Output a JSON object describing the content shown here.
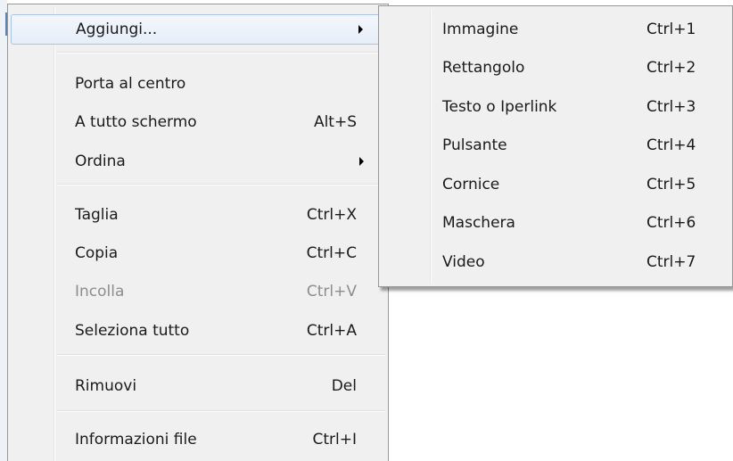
{
  "main_menu": {
    "add": {
      "label": "Aggiungi..."
    },
    "bring_to_center": {
      "label": "Porta al centro"
    },
    "full_screen": {
      "label": "A tutto schermo",
      "shortcut": "Alt+S"
    },
    "order": {
      "label": "Ordina"
    },
    "cut": {
      "label": "Taglia",
      "shortcut": "Ctrl+X"
    },
    "copy": {
      "label": "Copia",
      "shortcut": "Ctrl+C"
    },
    "paste": {
      "label": "Incolla",
      "shortcut": "Ctrl+V",
      "disabled": true
    },
    "select_all": {
      "label": "Seleziona tutto",
      "shortcut": "Ctrl+A"
    },
    "remove": {
      "label": "Rimuovi",
      "shortcut": "Del"
    },
    "file_info": {
      "label": "Informazioni file",
      "shortcut": "Ctrl+I"
    }
  },
  "submenu": {
    "image": {
      "label": "Immagine",
      "shortcut": "Ctrl+1"
    },
    "rectangle": {
      "label": "Rettangolo",
      "shortcut": "Ctrl+2"
    },
    "text_link": {
      "label": "Testo o Iperlink",
      "shortcut": "Ctrl+3"
    },
    "button": {
      "label": "Pulsante",
      "shortcut": "Ctrl+4"
    },
    "frame": {
      "label": "Cornice",
      "shortcut": "Ctrl+5"
    },
    "mask": {
      "label": "Maschera",
      "shortcut": "Ctrl+6"
    },
    "video": {
      "label": "Video",
      "shortcut": "Ctrl+7"
    }
  },
  "icons": {
    "submenu_arrow": "chevron-right-icon"
  },
  "colors": {
    "menu_bg": "#f0f0f0",
    "hover_border": "#a9c3e6",
    "disabled_text": "#8d8d8d"
  }
}
